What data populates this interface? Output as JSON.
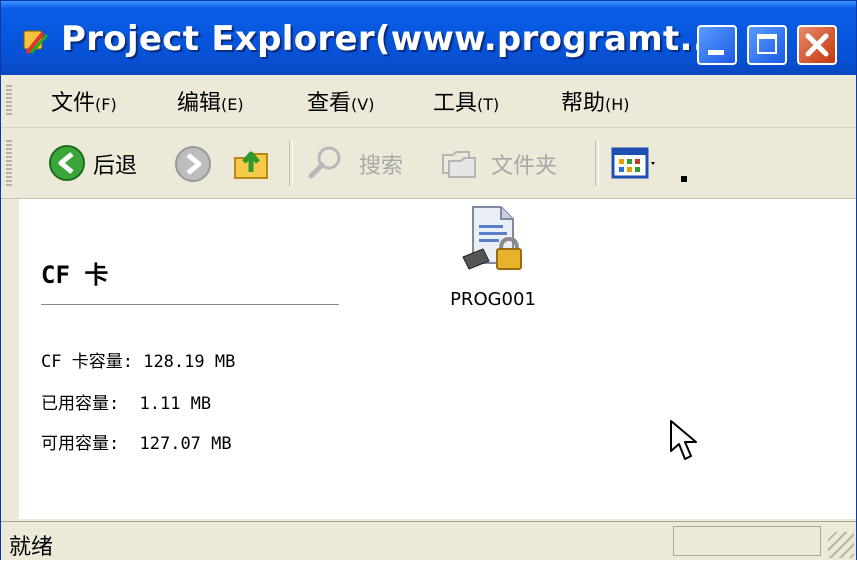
{
  "window": {
    "title": "Project Explorer(www.programt...",
    "controls": [
      "minimize",
      "maximize",
      "close"
    ]
  },
  "menu": {
    "items": [
      {
        "label": "文件",
        "key": "(F)"
      },
      {
        "label": "编辑",
        "key": "(E)"
      },
      {
        "label": "查看",
        "key": "(V)"
      },
      {
        "label": "工具",
        "key": "(T)"
      },
      {
        "label": "帮助",
        "key": "(H)"
      }
    ]
  },
  "toolbar": {
    "back_label": "后退",
    "search_label": "搜索",
    "folders_label": "文件夹"
  },
  "panel": {
    "title": "CF 卡",
    "capacity_label": "CF 卡容量:",
    "capacity_value": "128.19 MB",
    "used_label": "已用容量:",
    "used_value": "1.11 MB",
    "free_label": "可用容量:",
    "free_value": "127.07 MB"
  },
  "files": [
    {
      "name": "PROG001",
      "icon": "locked-program-file-icon"
    }
  ],
  "status": {
    "text": "就绪"
  },
  "colors": {
    "titlebar": "#0757df",
    "chrome": "#ece9d8",
    "close_button": "#c2360f"
  }
}
